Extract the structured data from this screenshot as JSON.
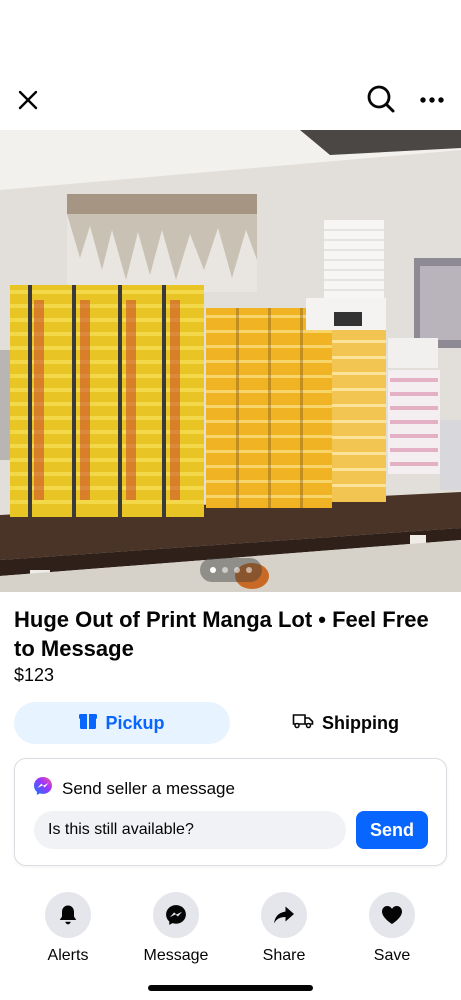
{
  "header": {
    "close_icon": "close-icon",
    "search_icon": "search-icon",
    "more_icon": "more-horizontal-icon"
  },
  "listing": {
    "photo_description_icon": "product-photo",
    "photo_pager": {
      "current": 1,
      "total": 4
    },
    "title": "Huge Out of Print Manga Lot • Feel Free to Message",
    "price": "$123"
  },
  "delivery": {
    "pickup_label": "Pickup",
    "shipping_label": "Shipping",
    "selected": "Pickup"
  },
  "message": {
    "heading": "Send seller a message",
    "input_value": "Is this still available?",
    "send_label": "Send"
  },
  "actions": [
    {
      "label": "Alerts",
      "icon": "bell-icon"
    },
    {
      "label": "Message",
      "icon": "messenger-icon"
    },
    {
      "label": "Share",
      "icon": "share-arrow-icon"
    },
    {
      "label": "Save",
      "icon": "heart-icon"
    }
  ],
  "colors": {
    "accent": "#0866ff",
    "accent_light": "#e7f3ff",
    "text": "#050505",
    "action_circle": "#e4e6eb"
  }
}
